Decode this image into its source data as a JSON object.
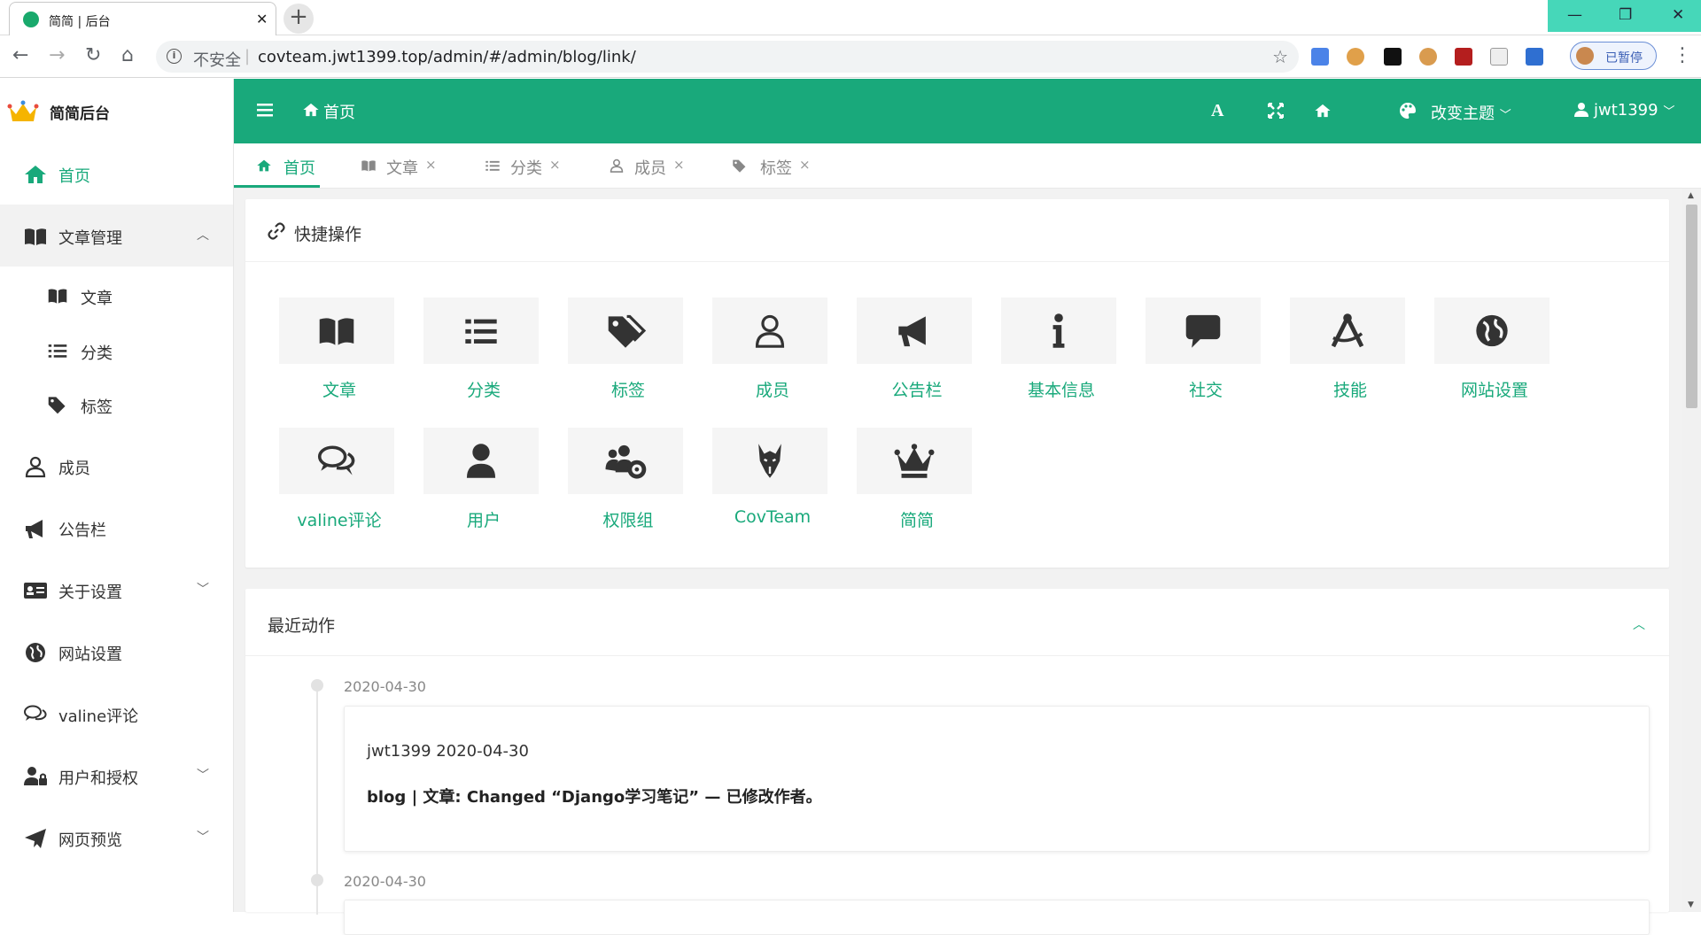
{
  "browser": {
    "tab_title": "简简 | 后台",
    "tab_close": "✕",
    "new_tab": "+",
    "security_label": "不安全",
    "url": "covteam.jwt1399.top/admin/#/admin/blog/link/",
    "profile_status": "已暂停",
    "window_controls": {
      "minimize": "—",
      "maximize": "❐",
      "close": "✕"
    }
  },
  "sidebar": {
    "brand": "简简后台",
    "items": [
      {
        "label": "首页",
        "icon": "home-icon"
      },
      {
        "label": "文章管理",
        "icon": "book-icon",
        "expanded": true
      },
      {
        "label": "成员",
        "icon": "user-icon"
      },
      {
        "label": "公告栏",
        "icon": "bullhorn-icon"
      },
      {
        "label": "关于设置",
        "icon": "id-card-icon",
        "collapsed": true
      },
      {
        "label": "网站设置",
        "icon": "globe-icon"
      },
      {
        "label": "valine评论",
        "icon": "comments-icon"
      },
      {
        "label": "用户和授权",
        "icon": "user-lock-icon",
        "collapsed": true
      },
      {
        "label": "网页预览",
        "icon": "paper-plane-icon",
        "collapsed": true
      }
    ],
    "subitems": [
      {
        "label": "文章",
        "icon": "book-icon"
      },
      {
        "label": "分类",
        "icon": "list-icon"
      },
      {
        "label": "标签",
        "icon": "tags-icon"
      }
    ]
  },
  "header": {
    "home_label": "首页",
    "theme_label": "改变主题",
    "user_label": "jwt1399"
  },
  "tabs": [
    {
      "label": "首页",
      "icon": "home-icon",
      "active": true
    },
    {
      "label": "文章",
      "icon": "book-icon",
      "close": "×"
    },
    {
      "label": "分类",
      "icon": "list-icon",
      "close": "×"
    },
    {
      "label": "成员",
      "icon": "user-icon",
      "close": "×"
    },
    {
      "label": "标签",
      "icon": "tags-icon",
      "close": "×"
    }
  ],
  "quick": {
    "title": "快捷操作",
    "actions": [
      {
        "label": "文章",
        "icon": "book-icon"
      },
      {
        "label": "分类",
        "icon": "list-icon"
      },
      {
        "label": "标签",
        "icon": "tags-icon"
      },
      {
        "label": "成员",
        "icon": "user-icon"
      },
      {
        "label": "公告栏",
        "icon": "bullhorn-icon"
      },
      {
        "label": "基本信息",
        "icon": "info-icon"
      },
      {
        "label": "社交",
        "icon": "comment-icon"
      },
      {
        "label": "技能",
        "icon": "compass-drafting-icon"
      },
      {
        "label": "网站设置",
        "icon": "globe-icon"
      },
      {
        "label": "valine评论",
        "icon": "comments-icon"
      },
      {
        "label": "用户",
        "icon": "user-solid-icon"
      },
      {
        "label": "权限组",
        "icon": "users-cog-icon"
      },
      {
        "label": "CovTeam",
        "icon": "wolf-icon"
      },
      {
        "label": "简简",
        "icon": "crown-icon"
      }
    ]
  },
  "recent": {
    "title": "最近动作",
    "entries": [
      {
        "date": "2020-04-30",
        "who": "jwt1399 2020-04-30",
        "message": "blog | 文章: Changed “Django学习笔记” — 已修改作者。"
      },
      {
        "date": "2020-04-30"
      }
    ]
  },
  "colors": {
    "accent": "#19a97b",
    "window_controls": "#46d7b9",
    "content_bg": "#f2f2f2"
  }
}
